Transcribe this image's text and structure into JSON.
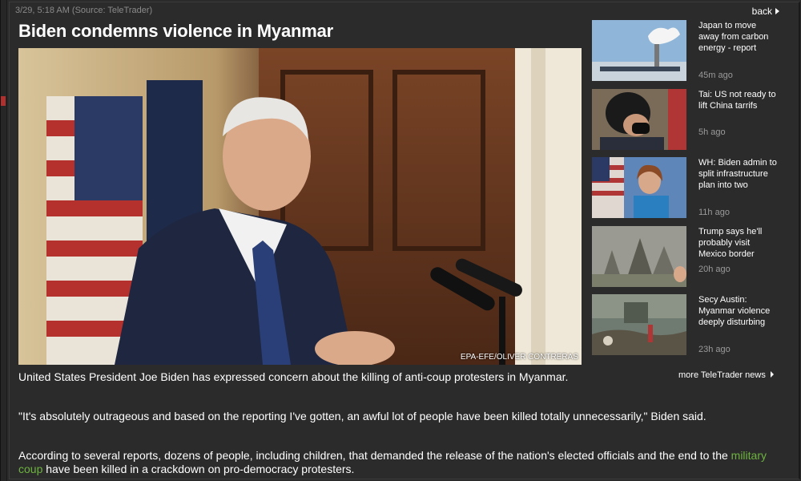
{
  "header": {
    "meta": "3/29, 5:18 AM (Source: TeleTrader)",
    "back_label": "back"
  },
  "article": {
    "title": "Biden condemns violence in Myanmar",
    "photo_credit": "EPA-EFE/OLIVER CONTRERAS",
    "p1": "United States President Joe Biden has expressed concern about the killing of anti-coup protesters in Myanmar.",
    "p2": "\"It's absolutely outrageous and based on the reporting I've gotten, an awful lot of people have been killed totally unnecessarily,\" Biden said.",
    "p3_before": "According to several reports, dozens of people, including children, that demanded the release of the nation's elected officials and the end to the ",
    "p3_link": "military coup",
    "p3_after": " have been killed in a crackdown on pro-democracy protesters."
  },
  "sidebar": {
    "items": [
      {
        "title": "Japan to move away from carbon energy - report",
        "age": "45m ago"
      },
      {
        "title": "Tai: US not ready to lift China tarrifs",
        "age": "5h ago"
      },
      {
        "title": "WH: Biden admin to split infrastructure plan into two",
        "age": "11h ago"
      },
      {
        "title": "Trump says he'll probably visit Mexico border",
        "age": "20h ago"
      },
      {
        "title": "Secy Austin: Myanmar violence deeply disturbing",
        "age": "23h ago"
      }
    ],
    "more_label": "more TeleTrader news"
  }
}
